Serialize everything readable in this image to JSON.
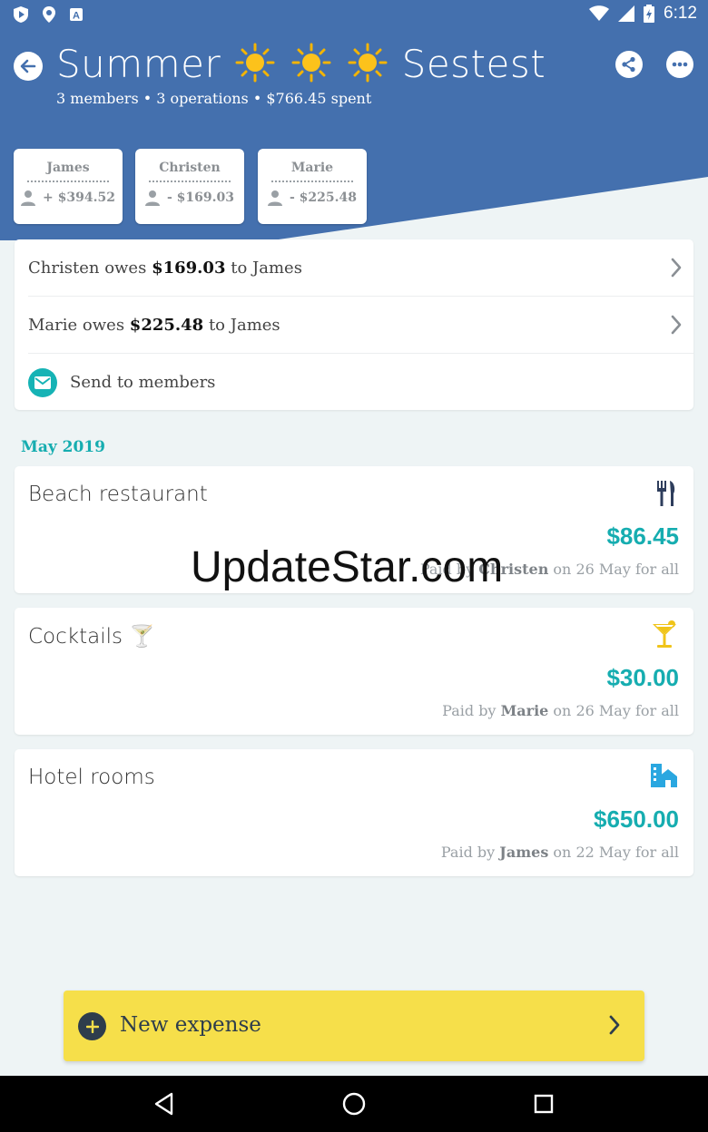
{
  "status_bar": {
    "time": "6:12"
  },
  "header": {
    "title_start": "Summer",
    "title_end": "Sestest",
    "subtitle": "3 members • 3 operations • $766.45 spent"
  },
  "members": [
    {
      "name": "James",
      "balance": "+ $394.52"
    },
    {
      "name": "Christen",
      "balance": "- $169.03"
    },
    {
      "name": "Marie",
      "balance": "- $225.48"
    }
  ],
  "debts": [
    {
      "from": "Christen",
      "verb": "owes",
      "amount": "$169.03",
      "prep": "to",
      "to": "James"
    },
    {
      "from": "Marie",
      "verb": "owes",
      "amount": "$225.48",
      "prep": "to",
      "to": "James"
    }
  ],
  "send_label": "Send to members",
  "month": "May 2019",
  "expenses": [
    {
      "name": "Beach restaurant",
      "icon": "cutlery-icon",
      "amount": "$86.45",
      "paid_prefix": "Paid by",
      "payer": "Christen",
      "paid_suffix": "on 26 May for all"
    },
    {
      "name": "Cocktails 🍸",
      "icon": "cocktail-icon",
      "amount": "$30.00",
      "paid_prefix": "Paid by",
      "payer": "Marie",
      "paid_suffix": "on 26 May for all"
    },
    {
      "name": "Hotel rooms",
      "icon": "hotel-icon",
      "amount": "$650.00",
      "paid_prefix": "Paid by",
      "payer": "James",
      "paid_suffix": "on 22 May for all"
    }
  ],
  "watermark": "UpdateStar.com",
  "new_expense_label": "New expense",
  "colors": {
    "header": "#4470ae",
    "accent": "#16adb0",
    "button": "#f6df4a"
  }
}
